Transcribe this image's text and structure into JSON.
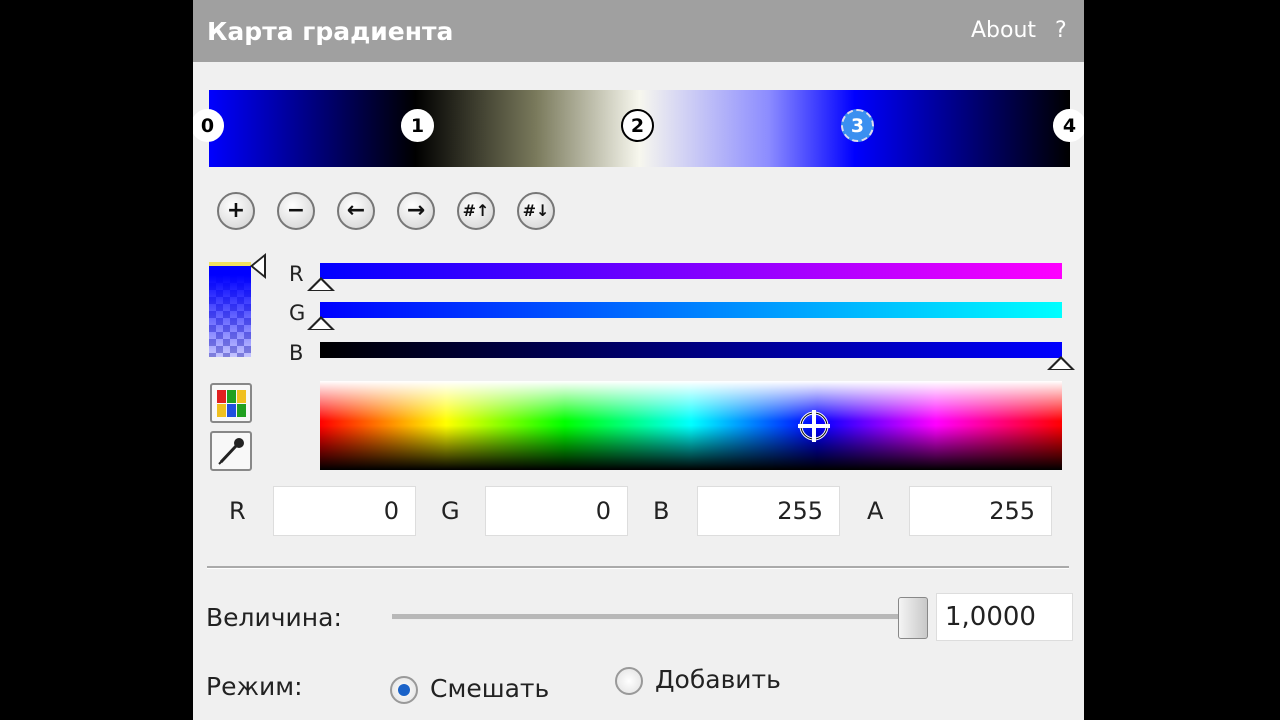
{
  "panel": {
    "title": "Карта градиента",
    "about_label": "About",
    "help_label": "?"
  },
  "gradient": {
    "stops": [
      {
        "label": "0",
        "color": "#0000ff"
      },
      {
        "label": "1",
        "color": "#000000"
      },
      {
        "label": "2",
        "color": "#f7f7ee"
      },
      {
        "label": "3",
        "color": "#0000ff",
        "selected": true
      },
      {
        "label": "4",
        "color": "#000000"
      }
    ]
  },
  "toolbar": {
    "buttons": [
      {
        "name": "add-stop",
        "glyph": "+"
      },
      {
        "name": "remove-stop",
        "glyph": "−"
      },
      {
        "name": "move-left",
        "glyph": "←"
      },
      {
        "name": "move-right",
        "glyph": "→"
      },
      {
        "name": "distribute-up",
        "glyph": "#↑"
      },
      {
        "name": "distribute-down",
        "glyph": "#↓"
      }
    ]
  },
  "channels": {
    "r_label": "R",
    "g_label": "G",
    "b_label": "B"
  },
  "values": {
    "r_label": "R",
    "r": "0",
    "g_label": "G",
    "g": "0",
    "b_label": "B",
    "b": "255",
    "a_label": "A",
    "a": "255"
  },
  "magnitude": {
    "label": "Величина:",
    "value": "1,0000",
    "level": 1.0
  },
  "mode": {
    "label": "Режим:",
    "options": [
      {
        "label": "Смешать",
        "selected": true
      },
      {
        "label": "Добавить",
        "selected": false
      }
    ]
  },
  "colors": {
    "title_bar": "#a0a0a0",
    "panel_bg": "#f0f0f0",
    "selected_stop": "#3a8ff0"
  }
}
